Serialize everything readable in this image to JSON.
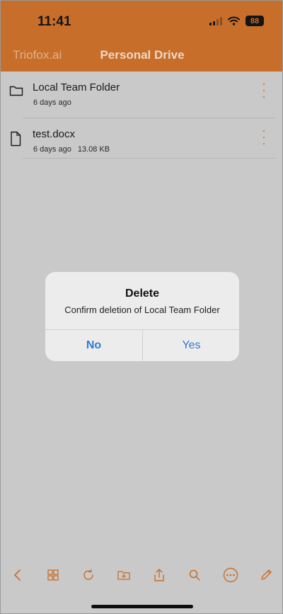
{
  "status": {
    "time": "11:41",
    "battery": "88"
  },
  "nav": {
    "back_label": "Triofox.ai",
    "title": "Personal Drive"
  },
  "files": [
    {
      "name": "Local Team Folder",
      "modified": "6 days ago",
      "size": "",
      "icon": "folder-icon"
    },
    {
      "name": "test.docx",
      "modified": "6 days ago",
      "size": "13.08 KB",
      "icon": "document-icon"
    }
  ],
  "dialog": {
    "title": "Delete",
    "message": "Confirm deletion of Local Team Folder",
    "no_label": "No",
    "yes_label": "Yes"
  },
  "toolbar": [
    "back-icon",
    "grid-view-icon",
    "refresh-icon",
    "new-folder-icon",
    "upload-icon",
    "search-icon",
    "more-icon",
    "edit-icon"
  ],
  "colors": {
    "accent": "#c76f2a",
    "dialog_button": "#2e7bd6",
    "overlay": "#c9c9c9"
  }
}
